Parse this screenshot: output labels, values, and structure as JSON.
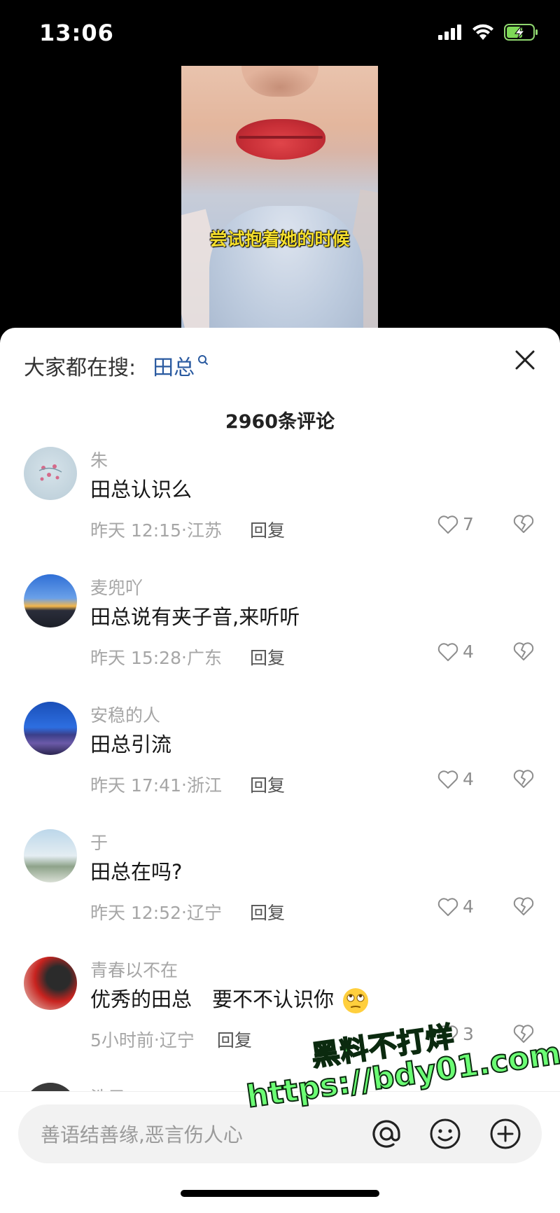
{
  "status_bar": {
    "time": "13:06"
  },
  "video": {
    "caption": "尝试抱着她的时候"
  },
  "search_hint": {
    "label": "大家都在搜:",
    "keyword": "田总"
  },
  "comment_count": "2960条评论",
  "comments": [
    {
      "username": "朱",
      "text": "田总认识么",
      "time": "昨天 12:15",
      "region": "江苏",
      "reply": "回复",
      "likes": "7"
    },
    {
      "username": "麦兜吖",
      "text": "田总说有夹子音,来听听",
      "time": "昨天 15:28",
      "region": "广东",
      "reply": "回复",
      "likes": "4"
    },
    {
      "username": "安稳的人",
      "text": "田总引流",
      "time": "昨天 17:41",
      "region": "浙江",
      "reply": "回复",
      "likes": "4"
    },
    {
      "username": "于",
      "text": "田总在吗?",
      "time": "昨天 12:52",
      "region": "辽宁",
      "reply": "回复",
      "likes": "4"
    },
    {
      "username": "青春以不在",
      "text": "优秀的田总　要不不认识你",
      "time": "5小时前",
      "region": "辽宁",
      "reply": "回复",
      "likes": "3"
    }
  ],
  "next_comment": {
    "username": "浩子"
  },
  "input": {
    "placeholder": "善语结善缘,恶言伤人心"
  },
  "watermark": {
    "line1": "黑料不打烊",
    "line2": "https://bdy01.com"
  },
  "colors": {
    "keyword": "#2a5aa0",
    "caption": "#f5df2d",
    "watermark": "#6bff74"
  }
}
